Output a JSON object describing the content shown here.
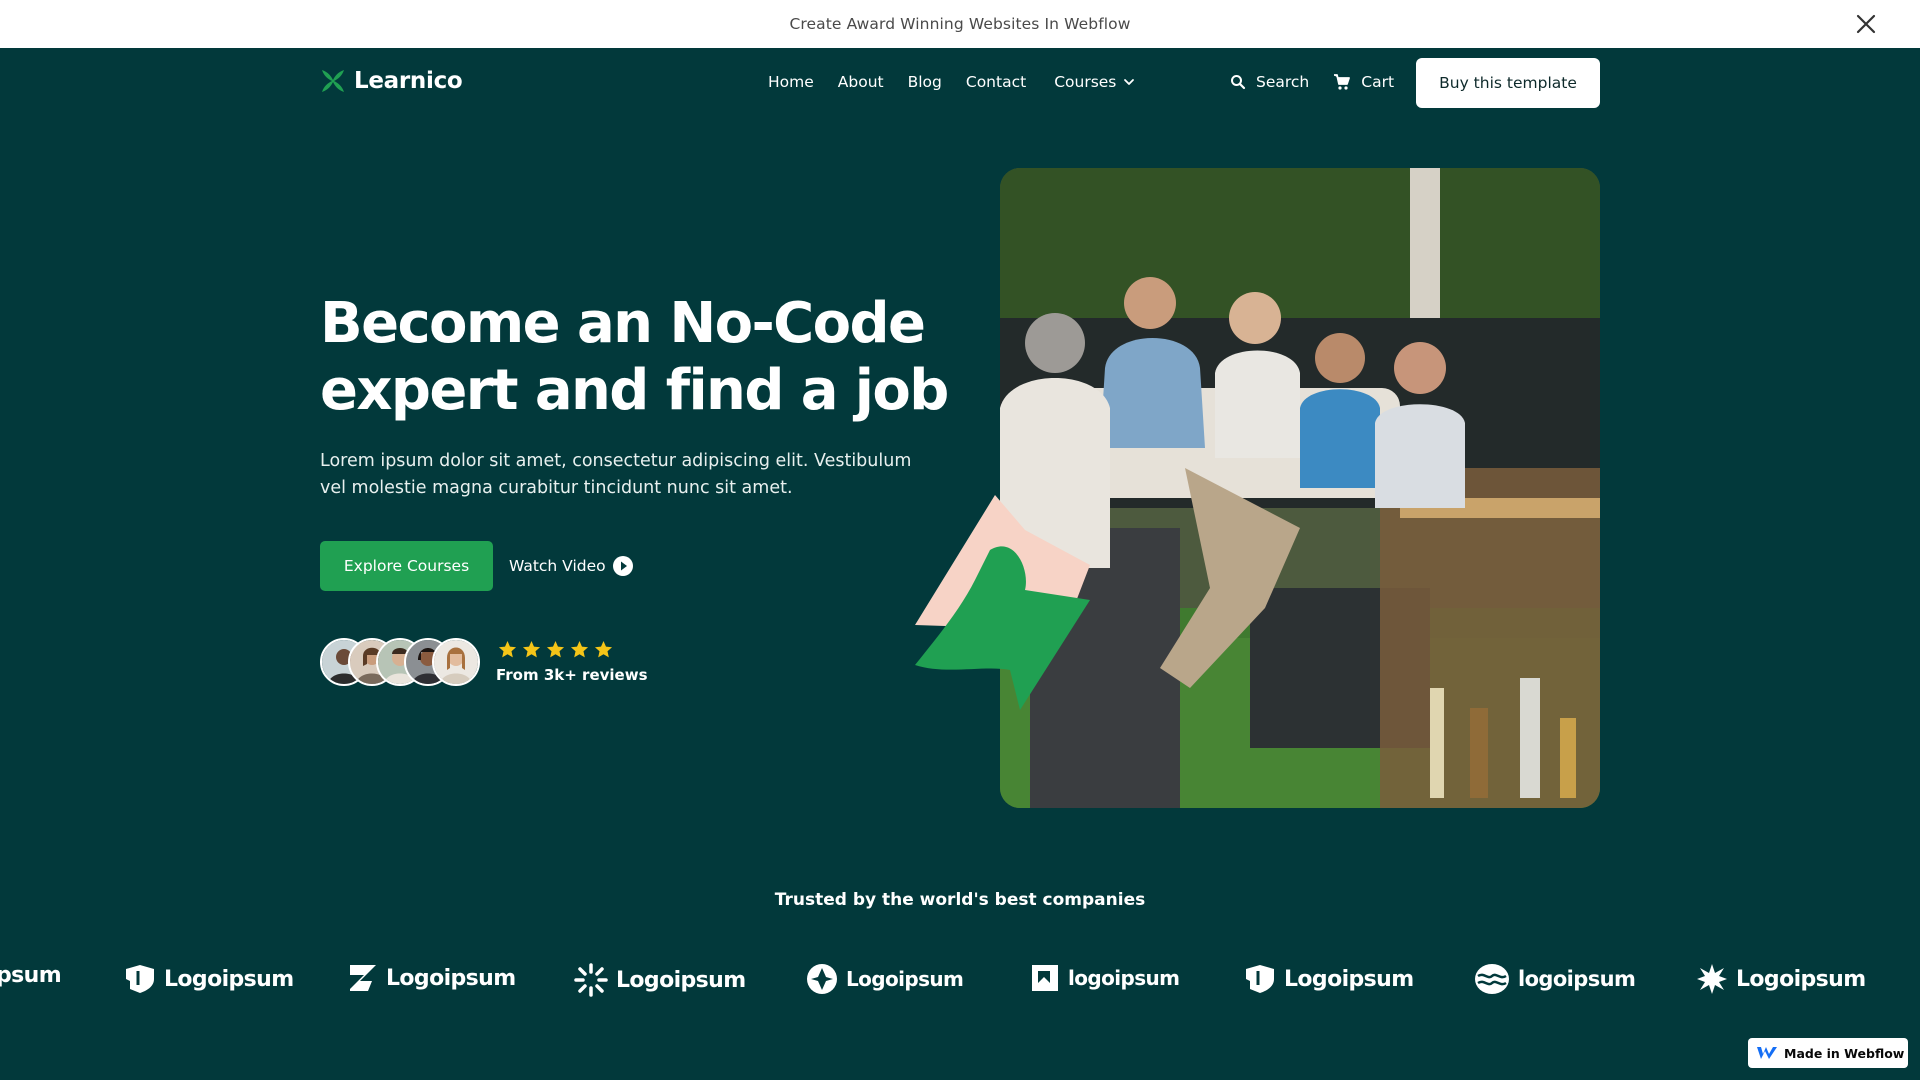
{
  "announcement": {
    "text": "Create Award Winning Websites In Webflow"
  },
  "brand": {
    "name": "Learnico",
    "accent": "#20a052",
    "background": "#02393b"
  },
  "nav": {
    "links": [
      "Home",
      "About",
      "Blog",
      "Contact",
      "Courses"
    ],
    "search_label": "Search",
    "cart_label": "Cart",
    "cta_label": "Buy this template"
  },
  "hero": {
    "title_line1": "Become an No-Code",
    "title_line2": "expert and find a job",
    "subtitle": "Lorem ipsum dolor sit amet, consectetur adipiscing elit. Vestibulum vel molestie magna curabitur tincidunt nunc sit amet.",
    "primary_cta": "Explore Courses",
    "secondary_cta": "Watch Video",
    "rating_stars": 5,
    "reviews_text": "From 3k+ reviews",
    "star_color": "#f5c518"
  },
  "trusted": {
    "heading": "Trusted by the world's best companies",
    "logos": [
      "psum",
      "Logoipsum",
      "Logoipsum",
      "Logoipsum",
      "Logoipsum",
      "logoipsum",
      "Logoipsum",
      "logoipsum",
      "Logoipsum"
    ]
  },
  "badge": {
    "text": "Made in Webflow"
  }
}
